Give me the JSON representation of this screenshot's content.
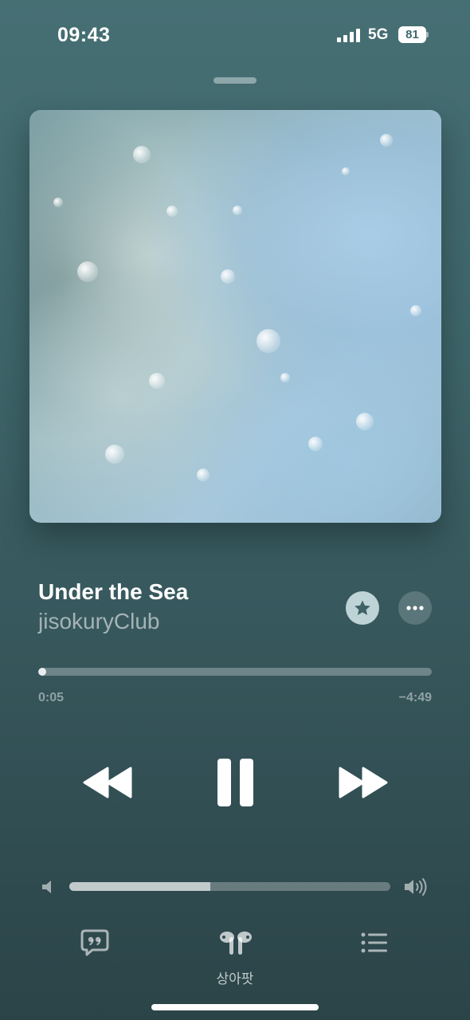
{
  "status_bar": {
    "time": "09:43",
    "network": "5G",
    "battery": "81",
    "signal_icon": "cellular-signal-icon"
  },
  "now_playing": {
    "title": "Under the Sea",
    "artist": "jisokuryClub",
    "favorite_icon": "star-icon",
    "more_icon": "ellipsis-icon"
  },
  "progress": {
    "elapsed": "0:05",
    "remaining": "−4:49",
    "fraction": 0.02
  },
  "controls": {
    "rewind_icon": "backward-icon",
    "pause_icon": "pause-icon",
    "forward_icon": "forward-icon"
  },
  "volume": {
    "level": 0.44,
    "low_icon": "speaker-low-icon",
    "high_icon": "speaker-high-icon"
  },
  "bottom_bar": {
    "lyrics_icon": "lyrics-quote-icon",
    "airplay_icon": "airpods-icon",
    "device_label": "상아팟",
    "queue_icon": "list-icon"
  },
  "colors": {
    "background_top": "#466f74",
    "background_bottom": "#2b4448"
  }
}
